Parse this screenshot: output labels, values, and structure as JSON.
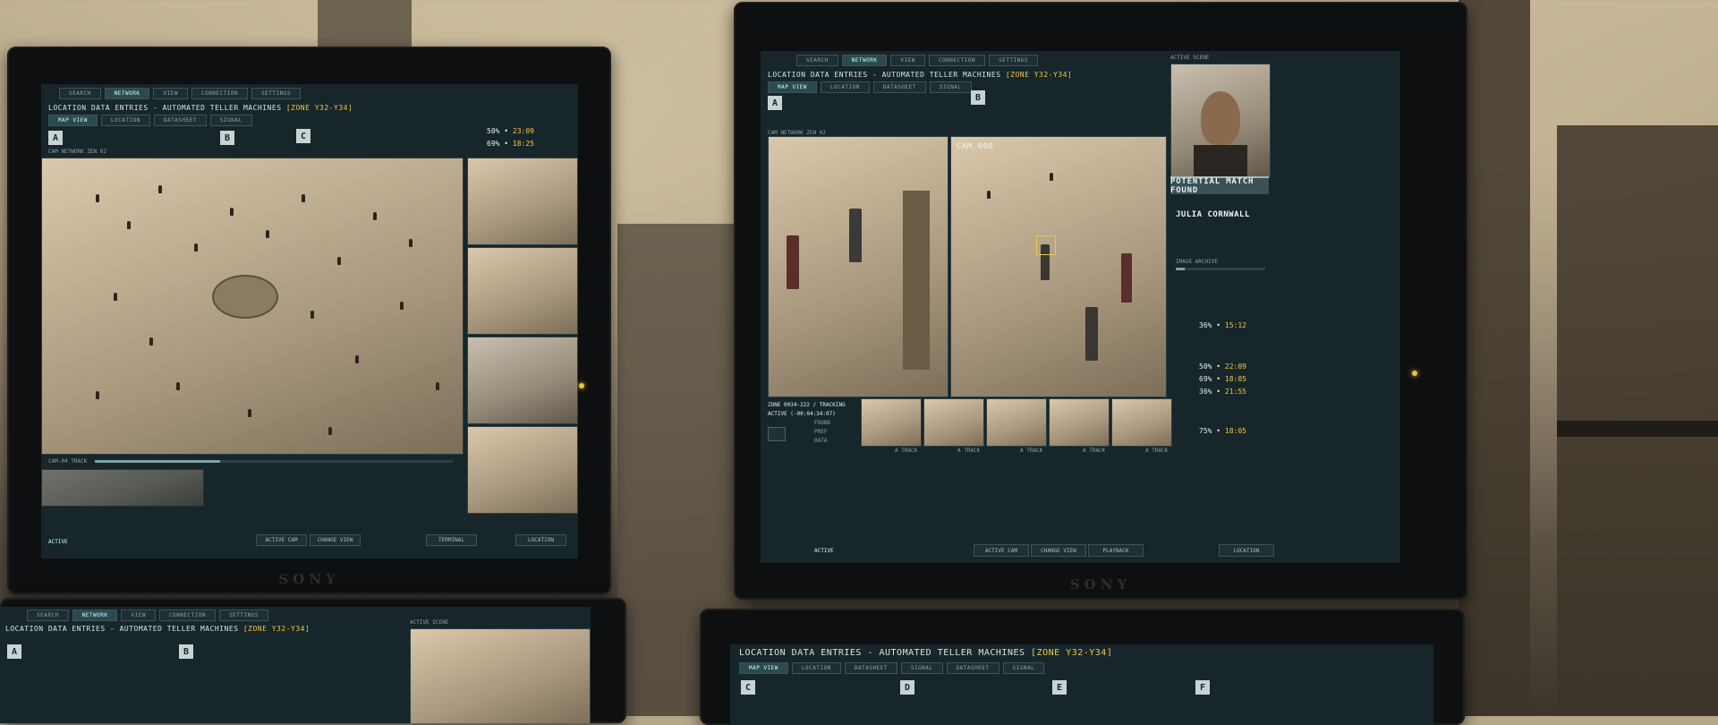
{
  "brand": "SONY",
  "tabs": [
    "SEARCH",
    "NETWORK",
    "VIEW",
    "CONNECTION",
    "SETTINGS"
  ],
  "subtabs": [
    "MAP VIEW",
    "LOCATION",
    "DATASHEET",
    "SIGNAL"
  ],
  "header_title": "LOCATION DATA ENTRIES - AUTOMATED TELLER MACHINES",
  "zone": "[ZONE Y32-Y34]",
  "badges": [
    "A",
    "B",
    "C"
  ],
  "left_screen": {
    "cam_network": "CAM NETWORK ZEN 02",
    "status": "ACTIVE",
    "track_label": "CAM-04 TRACK",
    "stats": [
      {
        "pct": "50%",
        "time": "23:09"
      },
      {
        "pct": "69%",
        "time": "18:25"
      }
    ],
    "footer_buttons": [
      "ACTIVE CAM",
      "CHANGE VIEW",
      "TERMINAL",
      "LOCATION"
    ]
  },
  "right_screen": {
    "cam_label": "CAM_008",
    "active_scene": "ACTIVE SCENE",
    "potential_match": "POTENTIAL MATCH FOUND",
    "match_name": "JULIA CORNWALL",
    "image_archive": "IMAGE ARCHIVE",
    "zone_line": "ZONE 0034-222 / TRACKING",
    "active_line": "ACTIVE (-00:04:34:07)",
    "path_labels": [
      "FOUND",
      "PREF",
      "DATA"
    ],
    "stats": [
      {
        "pct": "36%",
        "time": "15:12"
      },
      {
        "pct": "50%",
        "time": "22:09"
      },
      {
        "pct": "69%",
        "time": "18:05"
      },
      {
        "pct": "36%",
        "time": "21:55"
      },
      {
        "pct": "75%",
        "time": "18:05"
      }
    ],
    "thumb_label": "A TRACK",
    "footer_status": "ACTIVE",
    "footer_buttons": [
      "ACTIVE CAM",
      "CHANGE VIEW",
      "PLAYBACK",
      "LOCATION"
    ]
  },
  "bottom_screen": {
    "header_title": "LOCATION DATA ENTRIES - AUTOMATED TELLER MACHINES",
    "zone": "[ZONE Y32-Y34]",
    "active_scene": "ACTIVE SCENE",
    "badges": [
      "A",
      "B",
      "C",
      "D",
      "E",
      "F"
    ],
    "subtabs": [
      "MAP VIEW",
      "LOCATION",
      "DATASHEET",
      "SIGNAL",
      "DATASHEET",
      "SIGNAL"
    ]
  }
}
